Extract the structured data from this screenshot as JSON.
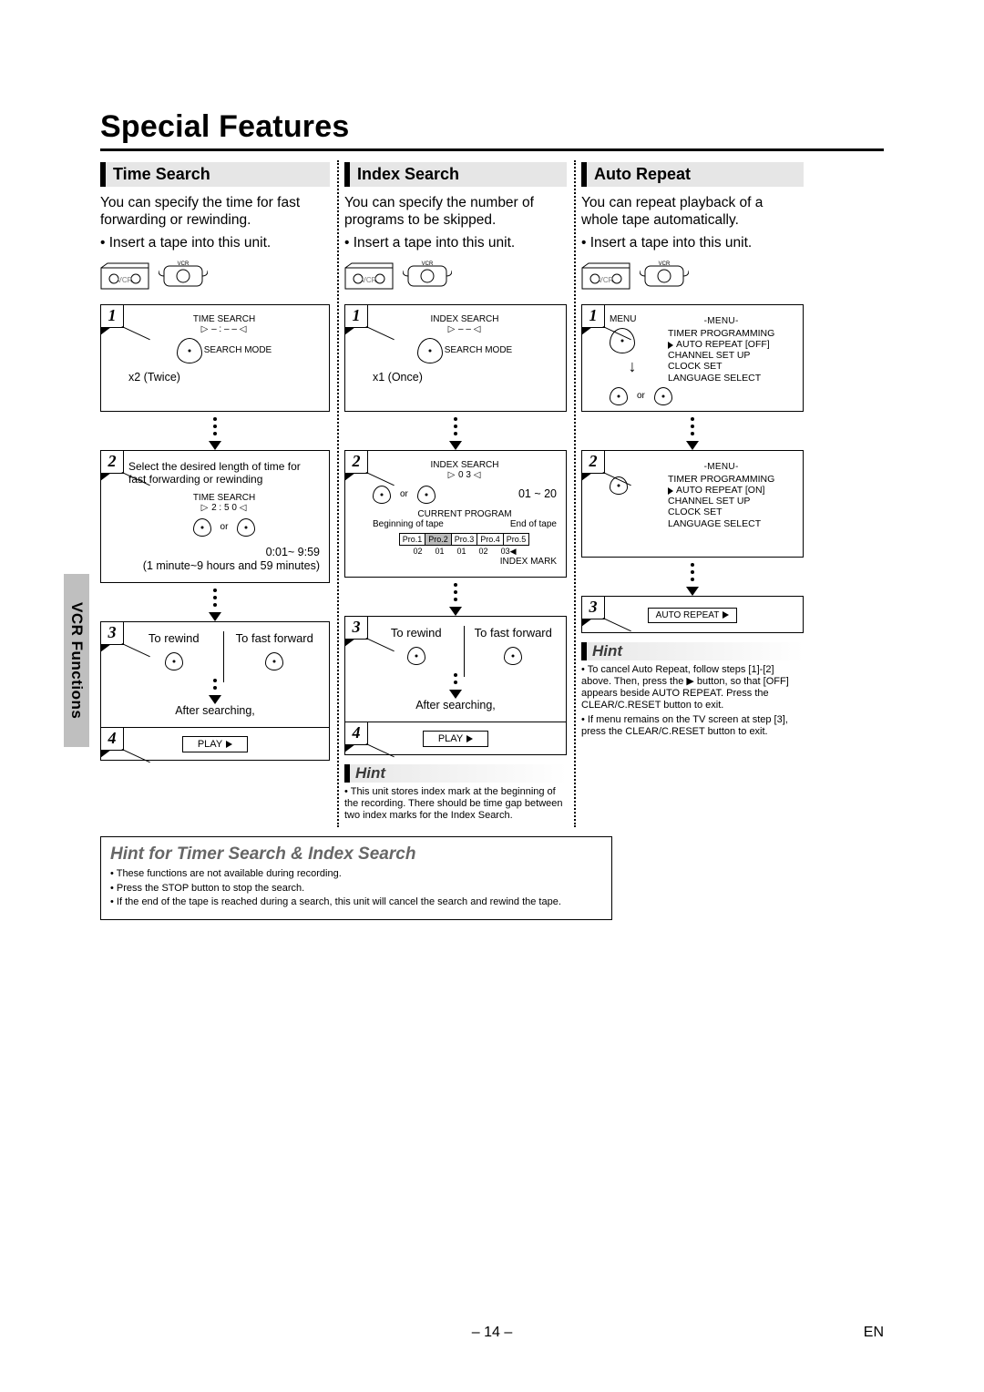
{
  "page": {
    "title": "Special Features",
    "sidebar": "VCR Functions",
    "number": "– 14 –",
    "lang": "EN"
  },
  "timeSearch": {
    "header": "Time Search",
    "intro": "You can specify the time for fast forwarding or rewinding.",
    "prep": "Insert a tape into this unit.",
    "step1": {
      "osd": "TIME SEARCH",
      "osdVal": "– : – –",
      "press": "x2 (Twice)",
      "button": "SEARCH MODE"
    },
    "step2": {
      "text": "Select the desired length of time for fast forwarding or rewinding",
      "osd": "TIME SEARCH",
      "osdVal": "2 : 5 0",
      "or": "or",
      "range": "0:01~ 9:59",
      "rangeNote": "(1 minute~9 hours and 59 minutes)"
    },
    "step3": {
      "left": "To rewind",
      "right": "To fast forward",
      "after": "After searching,"
    },
    "step4": {
      "play": "PLAY"
    }
  },
  "indexSearch": {
    "header": "Index Search",
    "intro": "You can specify the number of programs to be skipped.",
    "prep": "Insert a tape into this unit.",
    "step1": {
      "osd": "INDEX SEARCH",
      "osdVal": "– –",
      "press": "x1 (Once)",
      "button": "SEARCH MODE"
    },
    "step2": {
      "osd": "INDEX SEARCH",
      "osdVal": "0 3",
      "or": "or",
      "range": "01 ~ 20",
      "cp": "CURRENT PROGRAM",
      "begin": "Beginning of tape",
      "end": "End of tape",
      "progs": [
        "Pro.1",
        "Pro.2",
        "Pro.3",
        "Pro.4",
        "Pro.5"
      ],
      "marks": [
        "02",
        "01",
        "01",
        "02",
        "03"
      ],
      "marksLabel": "INDEX MARK"
    },
    "step3": {
      "left": "To rewind",
      "right": "To fast forward",
      "after": "After searching,"
    },
    "step4": {
      "play": "PLAY"
    },
    "hint": {
      "title": "Hint",
      "line": "This unit stores index mark at the beginning of the recording. There should be time gap between two index marks for the Index Search."
    }
  },
  "autoRepeat": {
    "header": "Auto Repeat",
    "intro": "You can repeat playback of a whole tape automatically.",
    "prep": "Insert a tape into this unit.",
    "menuLabel": "MENU",
    "step1": {
      "osdTitle": "-MENU-",
      "lines": [
        "TIMER PROGRAMMING",
        "AUTO REPEAT   [OFF]",
        "CHANNEL SET UP",
        "CLOCK SET",
        "LANGUAGE SELECT"
      ],
      "or": "or"
    },
    "step2": {
      "osdTitle": "-MENU-",
      "lines": [
        "TIMER PROGRAMMING",
        "AUTO REPEAT   [ON]",
        "CHANNEL SET UP",
        "CLOCK SET",
        "LANGUAGE SELECT"
      ]
    },
    "step3": {
      "box": "AUTO REPEAT"
    },
    "hint": {
      "title": "Hint",
      "l1": "To cancel Auto Repeat, follow steps [1]-[2] above. Then, press the ▶ button, so that [OFF] appears beside AUTO REPEAT.  Press the CLEAR/C.RESET button to exit.",
      "l2": "If menu remains on the TV screen at step [3], press the CLEAR/C.RESET button to exit."
    }
  },
  "bigHint": {
    "title": "Hint for Timer Search & Index Search",
    "l1": "These functions are not available during recording.",
    "l2": "Press the STOP button to stop the search.",
    "l3": "If the end of the tape is reached during a search, this unit will cancel the search and rewind the tape."
  }
}
